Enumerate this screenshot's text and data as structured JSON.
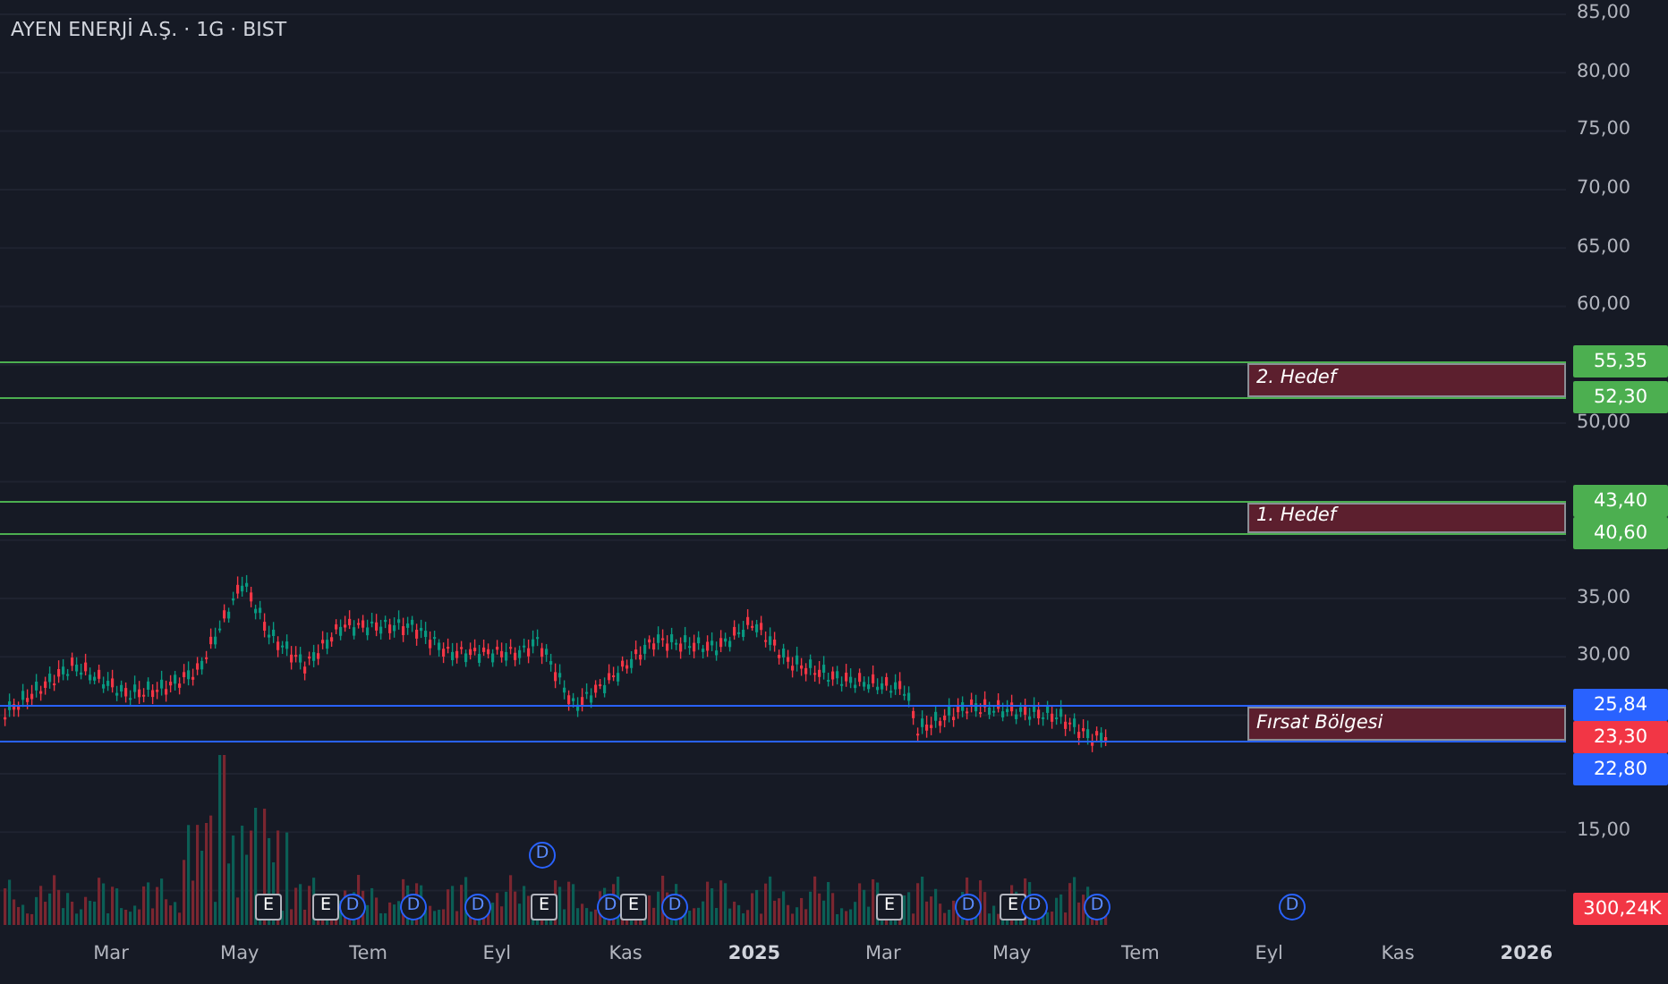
{
  "legend": {
    "title": "AYEN ENERJİ A.Ş. · 1G · BIST"
  },
  "price_axis": {
    "ticks": [
      "85,00",
      "80,00",
      "75,00",
      "70,00",
      "65,00",
      "60,00",
      "50,00",
      "35,00",
      "30,00",
      "15,00"
    ]
  },
  "zones": [
    {
      "label": "2. Hedef",
      "upper": {
        "value": "55,35",
        "color": "#4caf50"
      },
      "lower": {
        "value": "52,30",
        "color": "#4caf50"
      }
    },
    {
      "label": "1. Hedef",
      "upper": {
        "value": "43,40",
        "color": "#4caf50"
      },
      "lower": {
        "value": "40,60",
        "color": "#4caf50"
      }
    },
    {
      "label": "Fırsat Bölgesi",
      "upper": {
        "value": "25,84",
        "color": "#2962ff"
      },
      "lower": {
        "value": "22,80",
        "color": "#2962ff"
      }
    }
  ],
  "last_price": {
    "value": "23,30",
    "color": "#f23645"
  },
  "volume_label": {
    "value": "300,24K",
    "color": "#f23645"
  },
  "events": [
    {
      "kind": "earnings",
      "text": "E"
    },
    {
      "kind": "earnings",
      "text": "E"
    },
    {
      "kind": "dividend",
      "text": "D"
    },
    {
      "kind": "dividend",
      "text": "D"
    },
    {
      "kind": "dividend",
      "text": "D"
    },
    {
      "kind": "dividend",
      "text": "D"
    },
    {
      "kind": "earnings",
      "text": "E"
    },
    {
      "kind": "dividend",
      "text": "D"
    },
    {
      "kind": "earnings",
      "text": "E"
    },
    {
      "kind": "dividend",
      "text": "D"
    },
    {
      "kind": "earnings",
      "text": "E"
    },
    {
      "kind": "dividend",
      "text": "D"
    },
    {
      "kind": "earnings",
      "text": "E"
    },
    {
      "kind": "dividend",
      "text": "D"
    },
    {
      "kind": "dividend",
      "text": "D"
    },
    {
      "kind": "dividend",
      "text": "D"
    }
  ],
  "time_axis": [
    {
      "label": "Mar",
      "kind": "month"
    },
    {
      "label": "May",
      "kind": "month"
    },
    {
      "label": "Tem",
      "kind": "month"
    },
    {
      "label": "Eyl",
      "kind": "month"
    },
    {
      "label": "Kas",
      "kind": "month"
    },
    {
      "label": "2025",
      "kind": "year"
    },
    {
      "label": "Mar",
      "kind": "month"
    },
    {
      "label": "May",
      "kind": "month"
    },
    {
      "label": "Tem",
      "kind": "month"
    },
    {
      "label": "Eyl",
      "kind": "month"
    },
    {
      "label": "Kas",
      "kind": "month"
    },
    {
      "label": "2026",
      "kind": "year"
    }
  ]
}
